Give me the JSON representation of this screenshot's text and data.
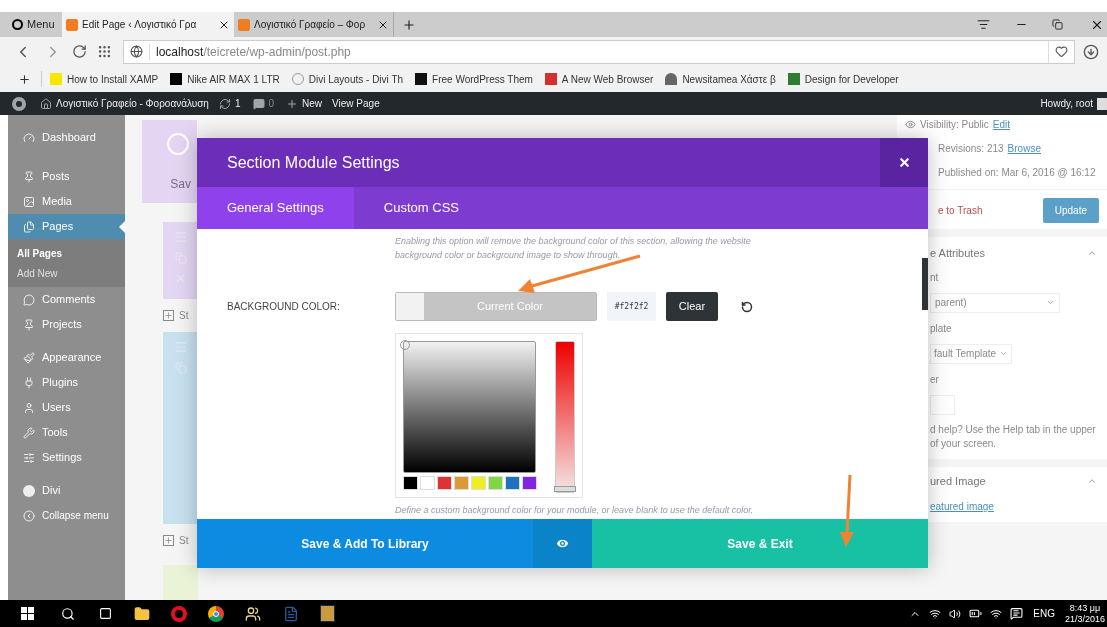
{
  "browser": {
    "menu_label": "Menu",
    "tabs": [
      {
        "title": "Edit Page ‹ Λογιστικό Γρα",
        "selected": true
      },
      {
        "title": "Λογιστικό Γραφείο – Φορ",
        "selected": false
      }
    ],
    "address": {
      "host": "localhost",
      "path": "/teicrete/wp-admin/post.php"
    },
    "bookmarks": [
      "How to Install XAMP",
      "Nike AIR MAX 1 LTR",
      "Divi Layouts - Divi Th",
      "Free WordPress Them",
      "A New Web Browser",
      "Newsitamea Χάστε β",
      "Design for Developer"
    ]
  },
  "admin_bar": {
    "site": "Λογιστικό Γραφείο - Φοροανάλυση",
    "updates": "1",
    "comments": "0",
    "new": "New",
    "view": "View Page",
    "greeting": "Howdy, root"
  },
  "sidebar": {
    "items": [
      {
        "label": "Dashboard",
        "selected": false
      },
      {
        "label": "Posts",
        "selected": false
      },
      {
        "label": "Media",
        "selected": false
      },
      {
        "label": "Pages",
        "selected": true,
        "children": [
          {
            "label": "All Pages",
            "selected": true
          },
          {
            "label": "Add New",
            "selected": false
          }
        ]
      },
      {
        "label": "Comments",
        "selected": false
      },
      {
        "label": "Projects",
        "selected": false
      },
      {
        "label": "Appearance",
        "selected": false
      },
      {
        "label": "Plugins",
        "selected": false
      },
      {
        "label": "Users",
        "selected": false
      },
      {
        "label": "Tools",
        "selected": false
      },
      {
        "label": "Settings",
        "selected": false
      },
      {
        "label": "Divi",
        "selected": false
      },
      {
        "label": "Collapse menu",
        "selected": false
      }
    ]
  },
  "builder": {
    "save_label": "Sav",
    "add_labels": [
      "St",
      "St"
    ]
  },
  "right_panel": {
    "visibility": "Visibility: Public",
    "visibility_link": "Edit",
    "revisions": "Revisions: 213",
    "revisions_link": "Browse",
    "published": "Published on: Mar 6, 2016 @ 16:12",
    "trash": "e to Trash",
    "update": "Update",
    "attributes_title": "e Attributes",
    "parent_label": "nt",
    "parent_value": "parent)",
    "template_label": "plate",
    "template_value": "fault Template",
    "order_label": "er",
    "help": "d help? Use the Help tab in the upper",
    "help_2": "of your screen.",
    "featured_title": "ured Image",
    "featured_link": "eatured image"
  },
  "modal": {
    "title": "Section Module Settings",
    "tabs": [
      {
        "label": "General Settings",
        "selected": true
      },
      {
        "label": "Custom CSS",
        "selected": false
      }
    ],
    "hint_top": "Enabling this option will remove the background color of this section, allowing the website background color or background image to show through.",
    "field_label": "BACKGROUND COLOR:",
    "current_color_label": "Current Color",
    "color": "#f2f2f2",
    "hex": "#f2f2f2",
    "clear": "Clear",
    "swatches": [
      {
        "color": "#000000"
      },
      {
        "color": "#ffffff"
      },
      {
        "color": "#dd3333"
      },
      {
        "color": "#dd9933"
      },
      {
        "color": "#eeee22"
      },
      {
        "color": "#81d742"
      },
      {
        "color": "#1e73be"
      },
      {
        "color": "#8224e3"
      }
    ],
    "hint_bottom": "Define a custom background color for your module, or leave blank to use the default color.",
    "hue_slider": {
      "level": 0
    },
    "save_library": "Save & Add To Library",
    "save_exit": "Save & Exit"
  },
  "taskbar": {
    "language": "ENG",
    "time": "8:43 μμ",
    "date": "21/3/2016"
  }
}
